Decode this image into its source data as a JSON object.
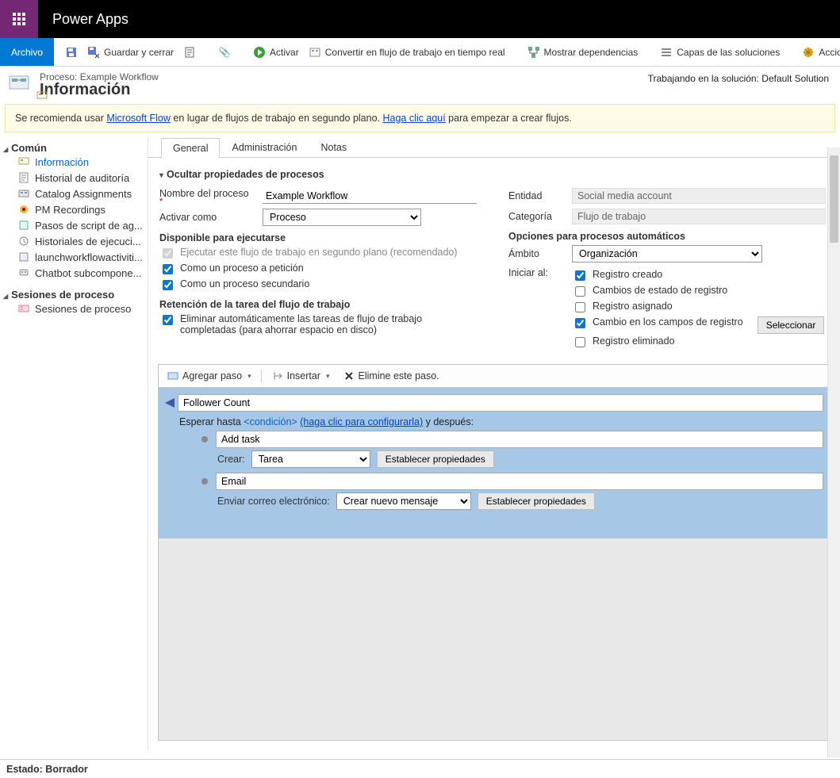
{
  "brand": "Power Apps",
  "toolbar": {
    "file": "Archivo",
    "save_close": "Guardar y cerrar",
    "activate": "Activar",
    "convert": "Convertir en flujo de trabajo en tiempo real",
    "show_deps": "Mostrar dependencias",
    "solution_layers": "Capas de las soluciones",
    "actions": "Acciones"
  },
  "header": {
    "pre": "Proceso: Example Workflow",
    "title": "Información",
    "right": "Trabajando en la solución: Default Solution"
  },
  "banner": {
    "p1": "Se recomienda usar ",
    "link1": "Microsoft Flow",
    "p2": " en lugar de flujos de trabajo en segundo plano. ",
    "link2": "Haga clic aquí",
    "p3": " para empezar a crear flujos."
  },
  "nav": {
    "g1": "Común",
    "items1": [
      "Información",
      "Historial de auditoría",
      "Catalog Assignments",
      "PM Recordings",
      "Pasos de script de ag...",
      "Historiales de ejecuci...",
      "launchworkflowactiviti...",
      "Chatbot subcompone..."
    ],
    "g2": "Sesiones de proceso",
    "items2": [
      "Sesiones de proceso"
    ]
  },
  "tabs": {
    "t1": "General",
    "t2": "Administración",
    "t3": "Notas"
  },
  "form": {
    "section": "Ocultar propiedades de procesos",
    "name_label": "Nombre del proceso",
    "name_value": "Example Workflow",
    "activate_as_label": "Activar como",
    "activate_as_value": "Proceso",
    "entity_label": "Entidad",
    "entity_value": "Social media account",
    "category_label": "Categoría",
    "category_value": "Flujo de trabajo",
    "exec_head": "Disponible para ejecutarse",
    "exec_bg": "Ejecutar este flujo de trabajo en segundo plano (recomendado)",
    "exec_demand": "Como un proceso a petición",
    "exec_child": "Como un proceso secundario",
    "retention_head": "Retención de la tarea del flujo de trabajo",
    "retention_chk": "Eliminar automáticamente las tareas de flujo de trabajo completadas (para ahorrar espacio en disco)",
    "auto_head": "Opciones para procesos automáticos",
    "scope_label": "Ámbito",
    "scope_value": "Organización",
    "start_label": "Iniciar al:",
    "start_create": "Registro creado",
    "start_status": "Cambios de estado de registro",
    "start_assign": "Registro asignado",
    "start_fieldchange": "Cambio en los campos de registro",
    "start_delete": "Registro eliminado",
    "select_btn": "Seleccionar"
  },
  "designer": {
    "add_step": "Agregar paso",
    "insert": "Insertar",
    "delete": "Elimine este paso.",
    "stage": "Follower Count",
    "wait_pre": "Esperar hasta ",
    "wait_cond_a": "<condición>",
    "wait_cond_b": "(haga clic para configurarla)",
    "wait_post": " y después:",
    "step1_title": "Add task",
    "step1_label": "Crear:",
    "step1_sel": "Tarea",
    "step1_btn": "Establecer propiedades",
    "step2_title": "Email",
    "step2_label": "Enviar correo electrónico:",
    "step2_sel": "Crear nuevo mensaje",
    "step2_btn": "Establecer propiedades"
  },
  "status": "Estado: Borrador"
}
